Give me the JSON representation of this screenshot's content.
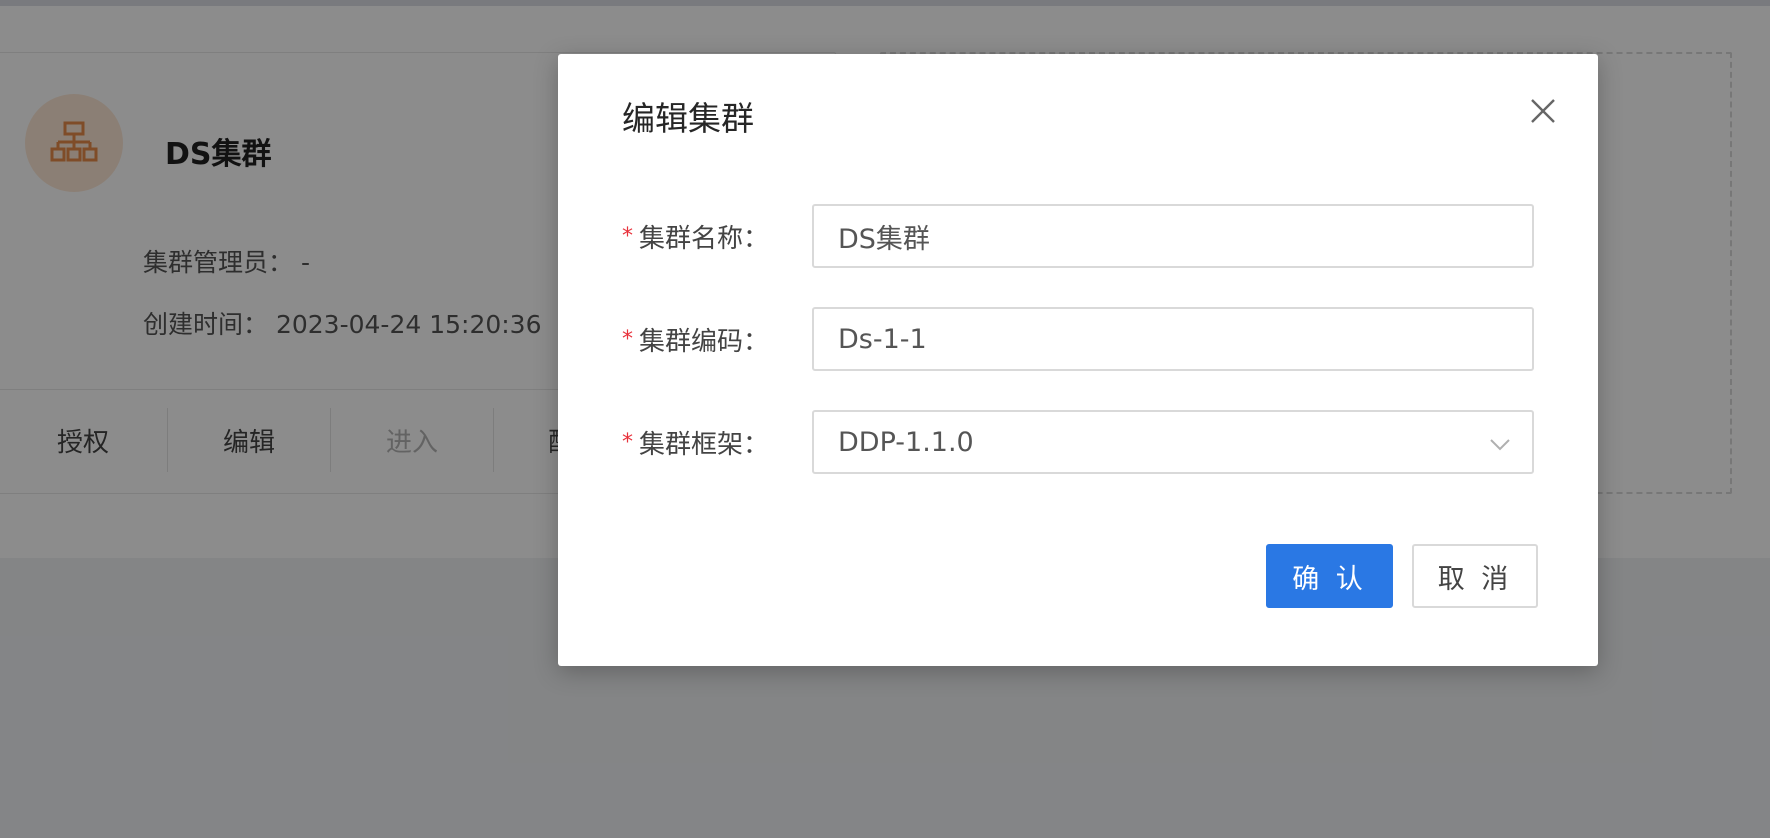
{
  "background_card": {
    "title": "DS集群",
    "admin_label": "集群管理员：",
    "admin_value": "-",
    "created_label": "创建时间：",
    "created_value": "2023-04-24 15:20:36",
    "actions": [
      {
        "label": "授权",
        "disabled": false
      },
      {
        "label": "编辑",
        "disabled": false
      },
      {
        "label": "进入",
        "disabled": true
      },
      {
        "label": "配置",
        "disabled": false
      }
    ],
    "icon": "cluster-icon"
  },
  "modal": {
    "title": "编辑集群",
    "close_icon": "close-icon",
    "fields": [
      {
        "label": "集群名称：",
        "value": "DS集群",
        "required": true
      },
      {
        "label": "集群编码：",
        "value": "Ds-1-1",
        "required": true
      },
      {
        "label": "集群框架：",
        "value": "DDP-1.1.0",
        "required": true,
        "type": "select"
      }
    ],
    "required_mark": "*",
    "confirm_label": "确 认",
    "cancel_label": "取 消"
  },
  "colors": {
    "primary": "#2a78e4",
    "required": "#e8323c",
    "cluster_icon": "#e88a4a",
    "mask": "rgba(0,0,0,0.45)"
  }
}
